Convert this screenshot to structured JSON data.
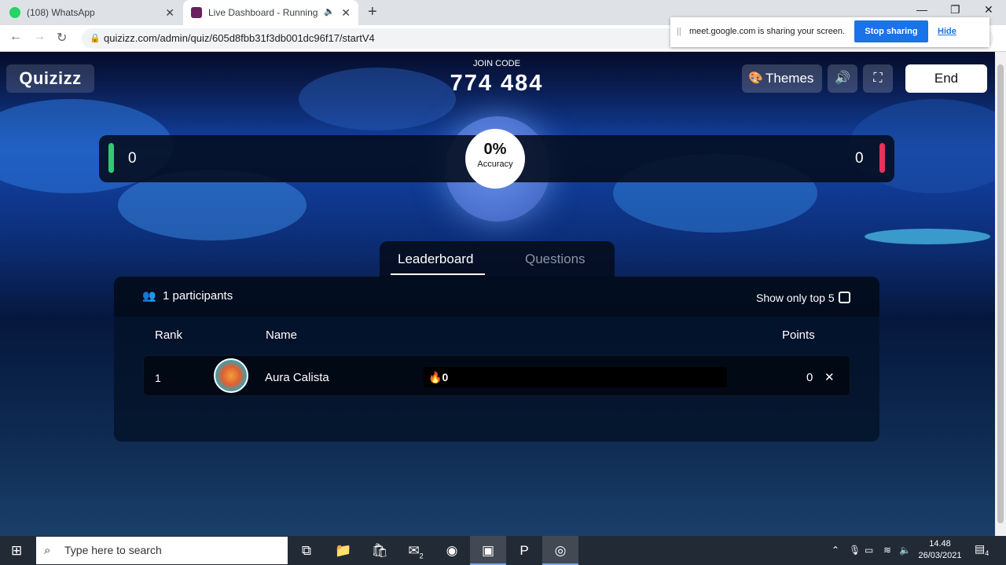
{
  "browser": {
    "tabs": [
      {
        "title": "(108) WhatsApp"
      },
      {
        "title": "Live Dashboard - Running"
      }
    ],
    "url": "quizizz.com/admin/quiz/605d8fbb31f3db001dc96f17/startV4"
  },
  "sharing": {
    "message": "meet.google.com is sharing your screen.",
    "stop_label": "Stop sharing",
    "hide_label": "Hide"
  },
  "header": {
    "logo": "Quizizz",
    "join_label": "JOIN CODE",
    "join_code": "774 484",
    "themes_label": "Themes",
    "end_label": "End"
  },
  "accuracy": {
    "correct": "0",
    "incorrect": "0",
    "percent": "0%",
    "label": "Accuracy"
  },
  "tabs": {
    "leaderboard": "Leaderboard",
    "questions": "Questions"
  },
  "leaderboard": {
    "participants": "1 participants",
    "top5_label": "Show only top 5",
    "columns": {
      "rank": "Rank",
      "name": "Name",
      "points": "Points"
    },
    "rows": [
      {
        "rank": "1",
        "name": "Aura Calista",
        "streak": "0",
        "points": "0"
      }
    ]
  },
  "taskbar": {
    "search_placeholder": "Type here to search",
    "mail_badge": "2",
    "time": "14.48",
    "date": "26/03/2021",
    "notifications": "4"
  },
  "colors": {
    "accent_green": "#2ecc71",
    "accent_red": "#e8315b",
    "share_blue": "#1a73e8"
  }
}
